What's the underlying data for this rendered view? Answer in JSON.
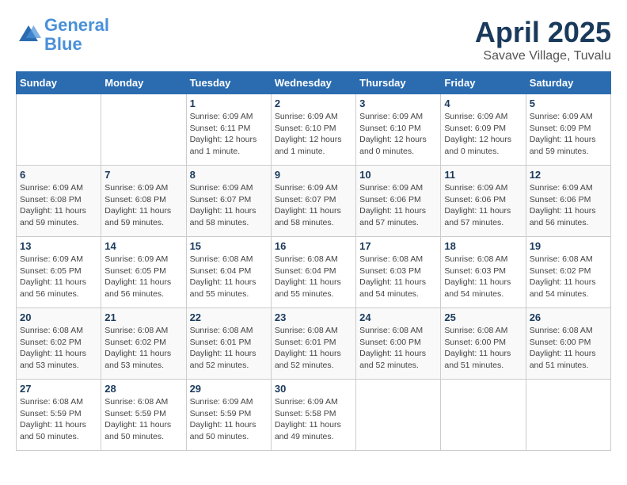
{
  "logo": {
    "line1": "General",
    "line2": "Blue"
  },
  "title": "April 2025",
  "location": "Savave Village, Tuvalu",
  "headers": [
    "Sunday",
    "Monday",
    "Tuesday",
    "Wednesday",
    "Thursday",
    "Friday",
    "Saturday"
  ],
  "weeks": [
    [
      {
        "day": "",
        "info": ""
      },
      {
        "day": "",
        "info": ""
      },
      {
        "day": "1",
        "info": "Sunrise: 6:09 AM\nSunset: 6:11 PM\nDaylight: 12 hours and 1 minute."
      },
      {
        "day": "2",
        "info": "Sunrise: 6:09 AM\nSunset: 6:10 PM\nDaylight: 12 hours and 1 minute."
      },
      {
        "day": "3",
        "info": "Sunrise: 6:09 AM\nSunset: 6:10 PM\nDaylight: 12 hours and 0 minutes."
      },
      {
        "day": "4",
        "info": "Sunrise: 6:09 AM\nSunset: 6:09 PM\nDaylight: 12 hours and 0 minutes."
      },
      {
        "day": "5",
        "info": "Sunrise: 6:09 AM\nSunset: 6:09 PM\nDaylight: 11 hours and 59 minutes."
      }
    ],
    [
      {
        "day": "6",
        "info": "Sunrise: 6:09 AM\nSunset: 6:08 PM\nDaylight: 11 hours and 59 minutes."
      },
      {
        "day": "7",
        "info": "Sunrise: 6:09 AM\nSunset: 6:08 PM\nDaylight: 11 hours and 59 minutes."
      },
      {
        "day": "8",
        "info": "Sunrise: 6:09 AM\nSunset: 6:07 PM\nDaylight: 11 hours and 58 minutes."
      },
      {
        "day": "9",
        "info": "Sunrise: 6:09 AM\nSunset: 6:07 PM\nDaylight: 11 hours and 58 minutes."
      },
      {
        "day": "10",
        "info": "Sunrise: 6:09 AM\nSunset: 6:06 PM\nDaylight: 11 hours and 57 minutes."
      },
      {
        "day": "11",
        "info": "Sunrise: 6:09 AM\nSunset: 6:06 PM\nDaylight: 11 hours and 57 minutes."
      },
      {
        "day": "12",
        "info": "Sunrise: 6:09 AM\nSunset: 6:06 PM\nDaylight: 11 hours and 56 minutes."
      }
    ],
    [
      {
        "day": "13",
        "info": "Sunrise: 6:09 AM\nSunset: 6:05 PM\nDaylight: 11 hours and 56 minutes."
      },
      {
        "day": "14",
        "info": "Sunrise: 6:09 AM\nSunset: 6:05 PM\nDaylight: 11 hours and 56 minutes."
      },
      {
        "day": "15",
        "info": "Sunrise: 6:08 AM\nSunset: 6:04 PM\nDaylight: 11 hours and 55 minutes."
      },
      {
        "day": "16",
        "info": "Sunrise: 6:08 AM\nSunset: 6:04 PM\nDaylight: 11 hours and 55 minutes."
      },
      {
        "day": "17",
        "info": "Sunrise: 6:08 AM\nSunset: 6:03 PM\nDaylight: 11 hours and 54 minutes."
      },
      {
        "day": "18",
        "info": "Sunrise: 6:08 AM\nSunset: 6:03 PM\nDaylight: 11 hours and 54 minutes."
      },
      {
        "day": "19",
        "info": "Sunrise: 6:08 AM\nSunset: 6:02 PM\nDaylight: 11 hours and 54 minutes."
      }
    ],
    [
      {
        "day": "20",
        "info": "Sunrise: 6:08 AM\nSunset: 6:02 PM\nDaylight: 11 hours and 53 minutes."
      },
      {
        "day": "21",
        "info": "Sunrise: 6:08 AM\nSunset: 6:02 PM\nDaylight: 11 hours and 53 minutes."
      },
      {
        "day": "22",
        "info": "Sunrise: 6:08 AM\nSunset: 6:01 PM\nDaylight: 11 hours and 52 minutes."
      },
      {
        "day": "23",
        "info": "Sunrise: 6:08 AM\nSunset: 6:01 PM\nDaylight: 11 hours and 52 minutes."
      },
      {
        "day": "24",
        "info": "Sunrise: 6:08 AM\nSunset: 6:00 PM\nDaylight: 11 hours and 52 minutes."
      },
      {
        "day": "25",
        "info": "Sunrise: 6:08 AM\nSunset: 6:00 PM\nDaylight: 11 hours and 51 minutes."
      },
      {
        "day": "26",
        "info": "Sunrise: 6:08 AM\nSunset: 6:00 PM\nDaylight: 11 hours and 51 minutes."
      }
    ],
    [
      {
        "day": "27",
        "info": "Sunrise: 6:08 AM\nSunset: 5:59 PM\nDaylight: 11 hours and 50 minutes."
      },
      {
        "day": "28",
        "info": "Sunrise: 6:08 AM\nSunset: 5:59 PM\nDaylight: 11 hours and 50 minutes."
      },
      {
        "day": "29",
        "info": "Sunrise: 6:09 AM\nSunset: 5:59 PM\nDaylight: 11 hours and 50 minutes."
      },
      {
        "day": "30",
        "info": "Sunrise: 6:09 AM\nSunset: 5:58 PM\nDaylight: 11 hours and 49 minutes."
      },
      {
        "day": "",
        "info": ""
      },
      {
        "day": "",
        "info": ""
      },
      {
        "day": "",
        "info": ""
      }
    ]
  ]
}
